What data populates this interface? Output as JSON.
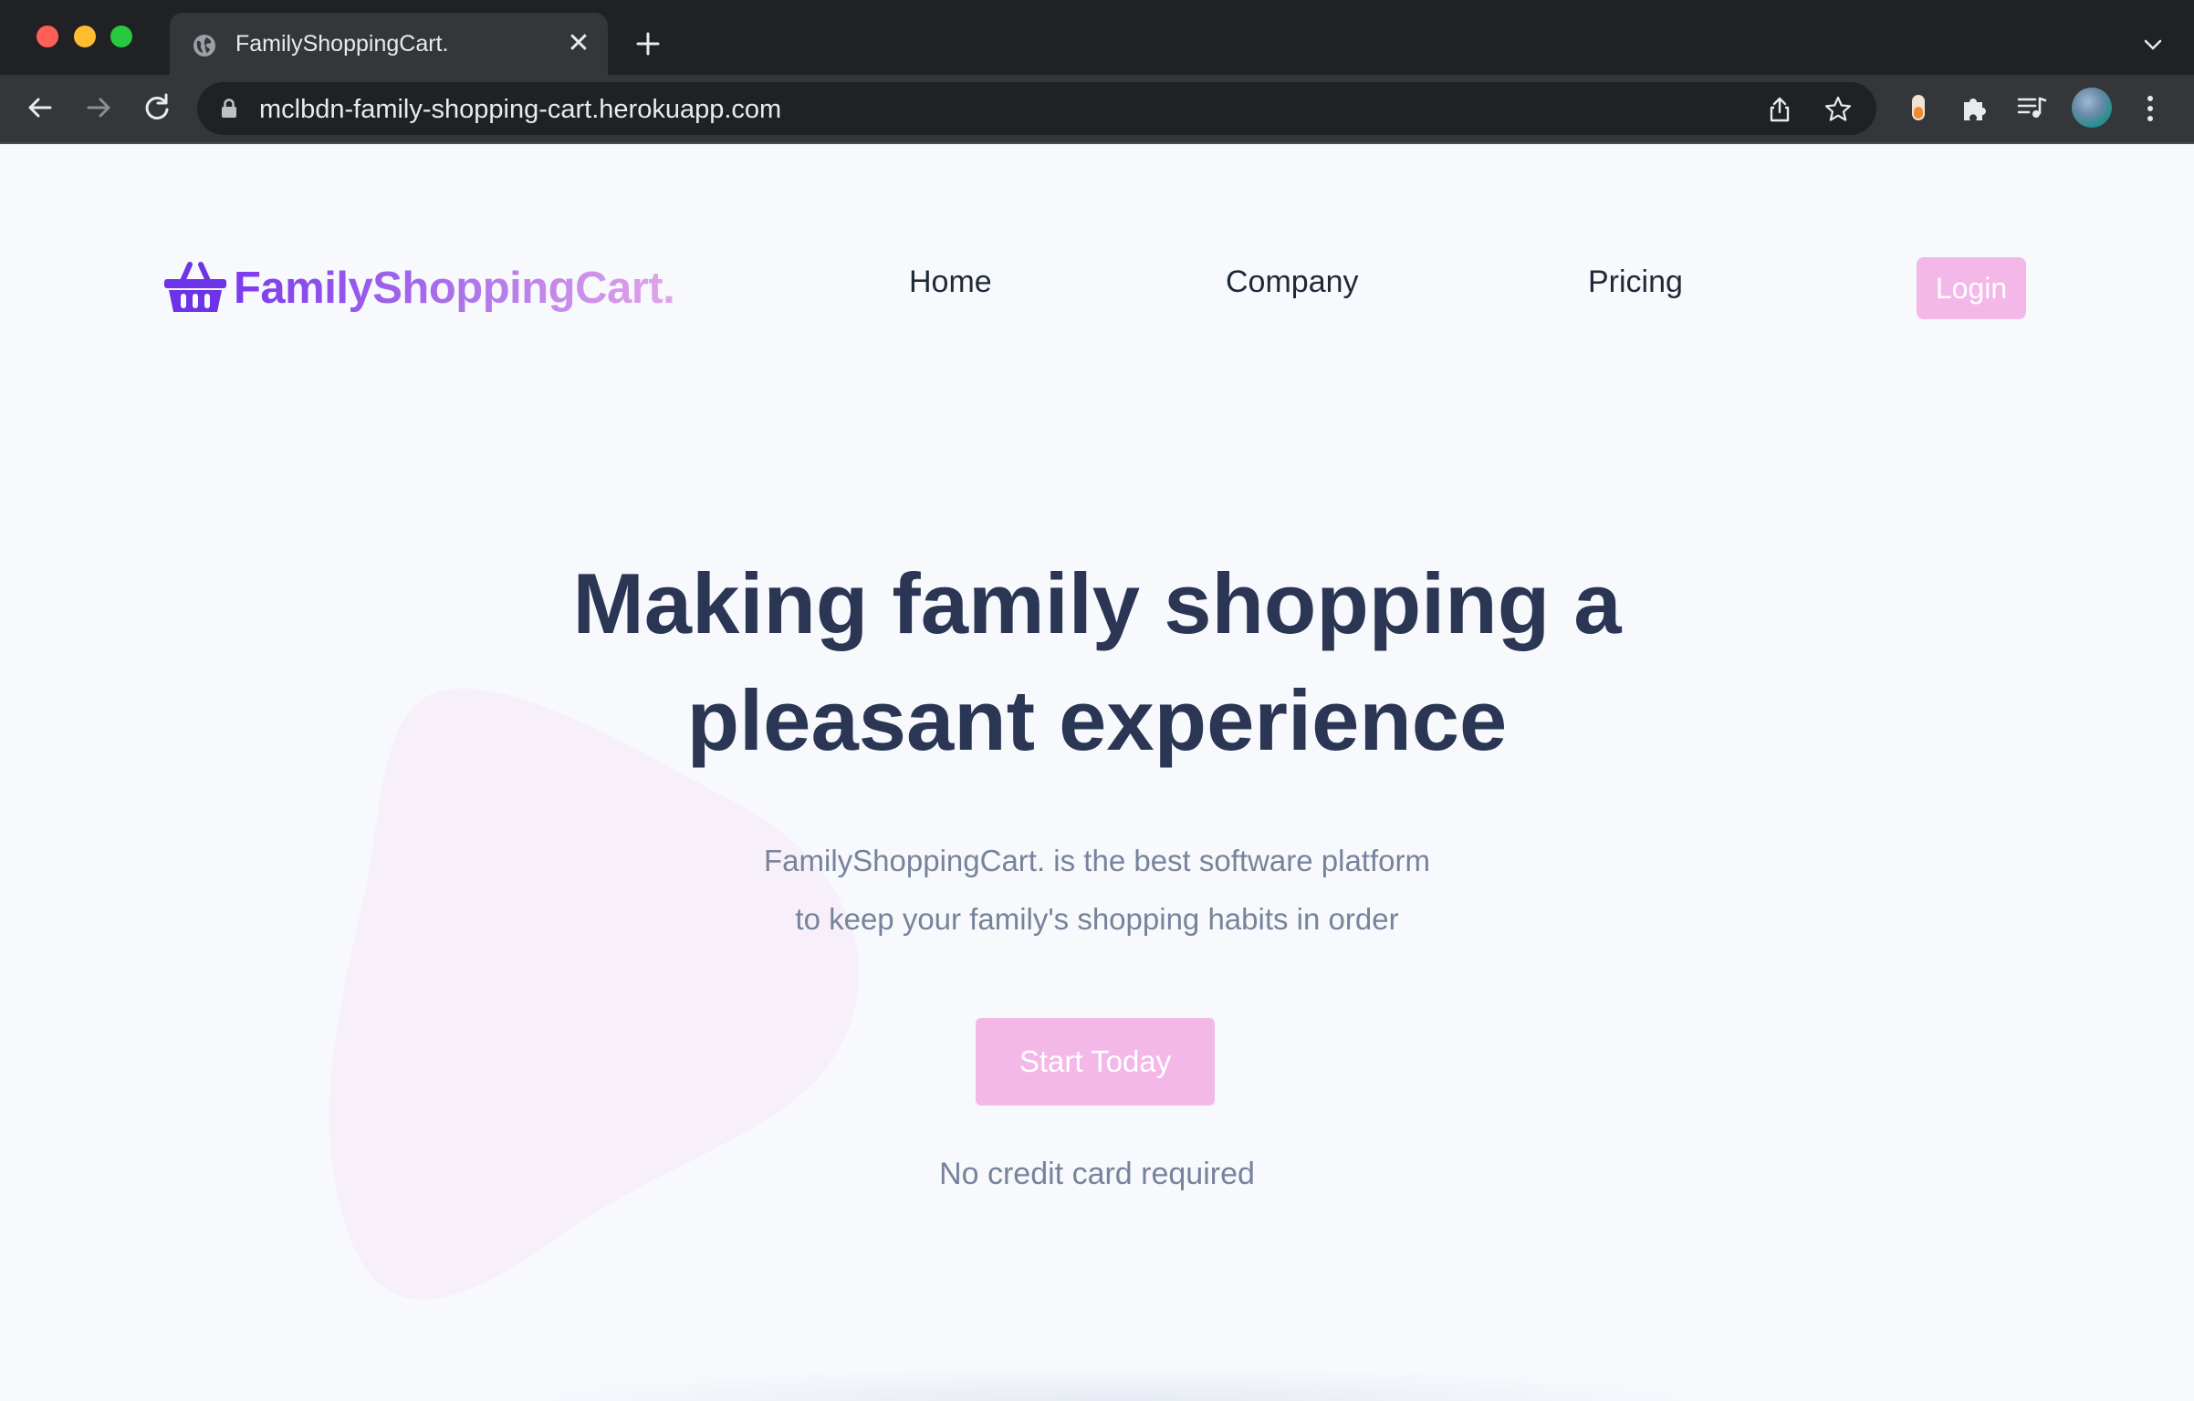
{
  "browser": {
    "tab": {
      "title": "FamilyShoppingCart.",
      "close_glyph": "✕"
    },
    "new_tab_icon": "plus-icon",
    "address_bar": {
      "url": "mclbdn-family-shopping-cart.herokuapp.com",
      "secure_icon": "lock-icon"
    },
    "toolbar_icons": [
      "back-arrow-icon",
      "forward-arrow-icon",
      "reload-icon",
      "share-icon",
      "star-icon",
      "extension-icon",
      "puzzle-icon",
      "media-queue-icon",
      "profile-avatar",
      "more-menu-icon"
    ]
  },
  "site": {
    "brand": {
      "name": "FamilyShoppingCart.",
      "icon": "basket-icon"
    },
    "nav": {
      "home": "Home",
      "company": "Company",
      "pricing": "Pricing",
      "login": "Login"
    },
    "hero": {
      "title_line1": "Making family shopping a",
      "title_line2": "pleasant experience",
      "subtitle_line1": "FamilyShoppingCart. is the best software platform",
      "subtitle_line2": "to keep your family's shopping habits in order",
      "cta": "Start Today",
      "note": "No credit card required"
    }
  },
  "colors": {
    "brand_gradient_start": "#7c3aed",
    "brand_gradient_end": "#e2a6e8",
    "button_pink": "#f3b8e8",
    "heading": "#2b3654",
    "muted_text": "#77839b",
    "page_background": "#f7f9fd"
  }
}
